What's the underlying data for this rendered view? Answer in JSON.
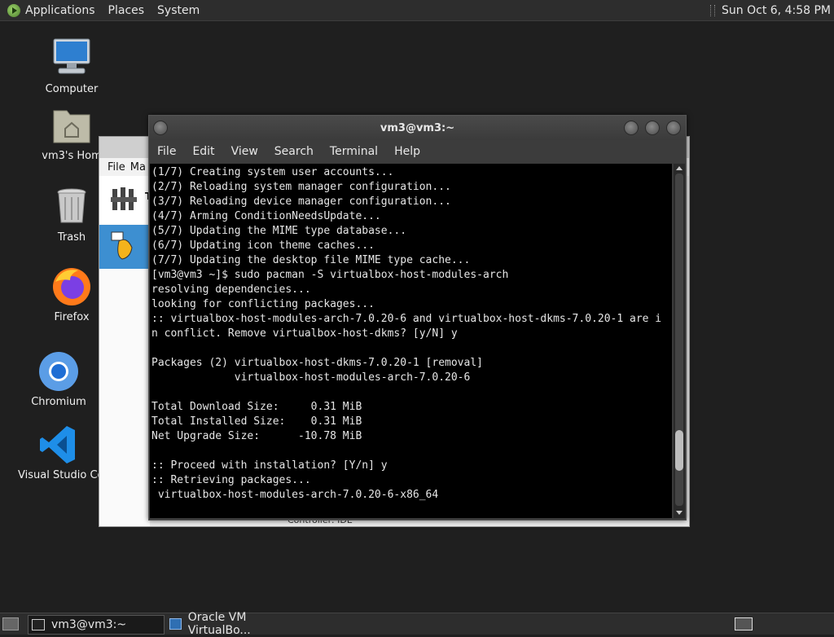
{
  "top_panel": {
    "menus": [
      "Applications",
      "Places",
      "System"
    ],
    "clock": "Sun Oct  6,  4:58 PM"
  },
  "desktop_icons": [
    {
      "name": "Computer",
      "icon": "computer-icon"
    },
    {
      "name": "vm3's Hom",
      "icon": "home-folder-icon"
    },
    {
      "name": "Trash",
      "icon": "trash-icon"
    },
    {
      "name": "Firefox",
      "icon": "firefox-icon"
    },
    {
      "name": "Chromium",
      "icon": "chromium-icon"
    },
    {
      "name": "Visual Studio Coc",
      "icon": "vscode-icon"
    }
  ],
  "vbox_window": {
    "menu": [
      "File",
      "Ma"
    ],
    "tools_label": "T",
    "status_text": "Controller: IDE"
  },
  "terminal": {
    "title": "vm3@vm3:~",
    "menu": [
      "File",
      "Edit",
      "View",
      "Search",
      "Terminal",
      "Help"
    ],
    "lines": [
      "(1/7) Creating system user accounts...",
      "(2/7) Reloading system manager configuration...",
      "(3/7) Reloading device manager configuration...",
      "(4/7) Arming ConditionNeedsUpdate...",
      "(5/7) Updating the MIME type database...",
      "(6/7) Updating icon theme caches...",
      "(7/7) Updating the desktop file MIME type cache...",
      "[vm3@vm3 ~]$ sudo pacman -S virtualbox-host-modules-arch",
      "resolving dependencies...",
      "looking for conflicting packages...",
      ":: virtualbox-host-modules-arch-7.0.20-6 and virtualbox-host-dkms-7.0.20-1 are i",
      "n conflict. Remove virtualbox-host-dkms? [y/N] y",
      "",
      "Packages (2) virtualbox-host-dkms-7.0.20-1 [removal]",
      "             virtualbox-host-modules-arch-7.0.20-6",
      "",
      "Total Download Size:     0.31 MiB",
      "Total Installed Size:    0.31 MiB",
      "Net Upgrade Size:      -10.78 MiB",
      "",
      ":: Proceed with installation? [Y/n] y",
      ":: Retrieving packages...",
      " virtualbox-host-modules-arch-7.0.20-6-x86_64"
    ],
    "scroll_position": 0.88
  },
  "taskbar": {
    "tasks": [
      {
        "label": "vm3@vm3:~",
        "icon": "terminal-icon",
        "active": true
      },
      {
        "label": "Oracle VM VirtualBo...",
        "icon": "virtualbox-icon",
        "active": false
      }
    ]
  }
}
